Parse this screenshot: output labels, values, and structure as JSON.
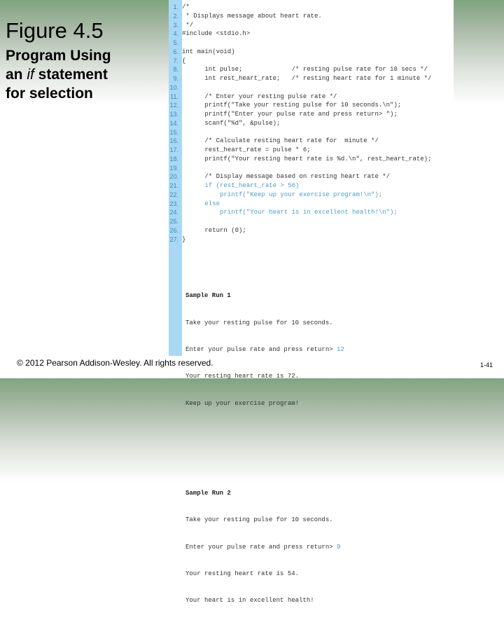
{
  "slide": {
    "figure_title": "Figure 4.5",
    "subtitle_line1": "Program Using",
    "subtitle_line2_pre": "an ",
    "subtitle_line2_em": "if",
    "subtitle_line2_post": " statement",
    "subtitle_line3": "for selection",
    "copyright": "© 2012 Pearson Addison-Wesley. All rights reserved.",
    "slide_number": "1-41"
  },
  "colors": {
    "gutter": "#aad8f4",
    "line_number": "#2a8fbf",
    "highlight_code": "#4a9ed0",
    "user_input": "#3a9ad0"
  },
  "code": {
    "lines": [
      {
        "n": "1.",
        "text": "/*",
        "hl": false
      },
      {
        "n": "2.",
        "text": " * Displays message about heart rate.",
        "hl": false
      },
      {
        "n": "3.",
        "text": " */",
        "hl": false
      },
      {
        "n": "4.",
        "text": "#include <stdio.h>",
        "hl": false
      },
      {
        "n": "5.",
        "text": "",
        "hl": false
      },
      {
        "n": "6.",
        "text": "int main(void)",
        "hl": false
      },
      {
        "n": "7.",
        "text": "{",
        "hl": false
      },
      {
        "n": "8.",
        "text": "      int pulse;             /* resting pulse rate for 10 secs */",
        "hl": false
      },
      {
        "n": "9.",
        "text": "      int rest_heart_rate;   /* resting heart rate for 1 minute */",
        "hl": false
      },
      {
        "n": "10.",
        "text": "",
        "hl": false
      },
      {
        "n": "11.",
        "text": "      /* Enter your resting pulse rate */",
        "hl": false
      },
      {
        "n": "12.",
        "text": "      printf(\"Take your resting pulse for 10 seconds.\\n\");",
        "hl": false
      },
      {
        "n": "13.",
        "text": "      printf(\"Enter your pulse rate and press return> \");",
        "hl": false
      },
      {
        "n": "14.",
        "text": "      scanf(\"%d\", &pulse);",
        "hl": false
      },
      {
        "n": "15.",
        "text": "",
        "hl": false
      },
      {
        "n": "16.",
        "text": "      /* Calculate resting heart rate for  minute */",
        "hl": false
      },
      {
        "n": "17.",
        "text": "      rest_heart_rate = pulse * 6;",
        "hl": false
      },
      {
        "n": "18.",
        "text": "      printf(\"Your resting heart rate is %d.\\n\", rest_heart_rate);",
        "hl": false
      },
      {
        "n": "19.",
        "text": "",
        "hl": false
      },
      {
        "n": "20.",
        "text": "      /* Display message based on resting heart rate */",
        "hl": false
      },
      {
        "n": "21.",
        "text": "      if (rest_heart_rate > 56)",
        "hl": true
      },
      {
        "n": "22.",
        "text": "          printf(\"Keep up your exercise program!\\n\");",
        "hl": true
      },
      {
        "n": "23.",
        "text": "      else",
        "hl": true
      },
      {
        "n": "24.",
        "text": "          printf(\"Your heart is in excellent health!\\n\");",
        "hl": true
      },
      {
        "n": "25.",
        "text": "",
        "hl": false
      },
      {
        "n": "26.",
        "text": "      return (0);",
        "hl": false
      },
      {
        "n": "27.",
        "text": "}",
        "hl": false
      }
    ]
  },
  "sample_runs": [
    {
      "title": "Sample Run 1",
      "line1": "Take your resting pulse for 10 seconds.",
      "line2_prompt": "Enter your pulse rate and press return> ",
      "line2_input": "12",
      "line3": "Your resting heart rate is 72.",
      "line4": "Keep up your exercise program!"
    },
    {
      "title": "Sample Run 2",
      "line1": "Take your resting pulse for 10 seconds.",
      "line2_prompt": "Enter your pulse rate and press return> ",
      "line2_input": "9",
      "line3": "Your resting heart rate is 54.",
      "line4": "Your heart is in excellent health!"
    }
  ]
}
